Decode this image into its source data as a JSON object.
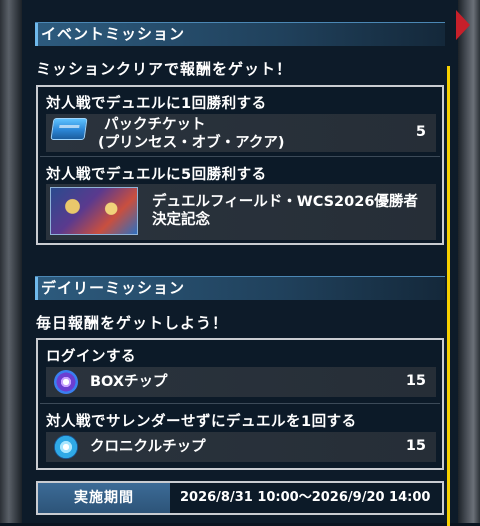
{
  "event_mission": {
    "header": "イベントミッション",
    "subtitle": "ミッションクリアで報酬をゲット！",
    "missions": [
      {
        "title": "対人戦でデュエルに1回勝利する",
        "reward_icon": "pack-ticket-icon",
        "reward_line1": "パックチケット",
        "reward_line2": "(プリンセス・オブ・アクア)",
        "quantity": "5"
      },
      {
        "title": "対人戦でデュエルに5回勝利する",
        "reward_icon": "duel-field-icon",
        "reward_line1": "デュエルフィールド・WCS2026優勝者",
        "reward_line2": "決定記念",
        "quantity": ""
      }
    ]
  },
  "daily_mission": {
    "header": "デイリーミッション",
    "subtitle": "毎日報酬をゲットしよう！",
    "missions": [
      {
        "title": "ログインする",
        "reward_icon": "box-chip-icon",
        "reward_name": "BOXチップ",
        "quantity": "15"
      },
      {
        "title": "対人戦でサレンダーせずにデュエルを1回する",
        "reward_icon": "chronicle-chip-icon",
        "reward_name": "クロニクルチップ",
        "quantity": "15"
      }
    ]
  },
  "period": {
    "label": "実施期間",
    "value": "2026/8/31 10:00〜2026/9/20 14:00"
  },
  "colors": {
    "accent": "#f6d000",
    "header_blue": "#2d5b7e",
    "border": "#c9ccd1"
  }
}
